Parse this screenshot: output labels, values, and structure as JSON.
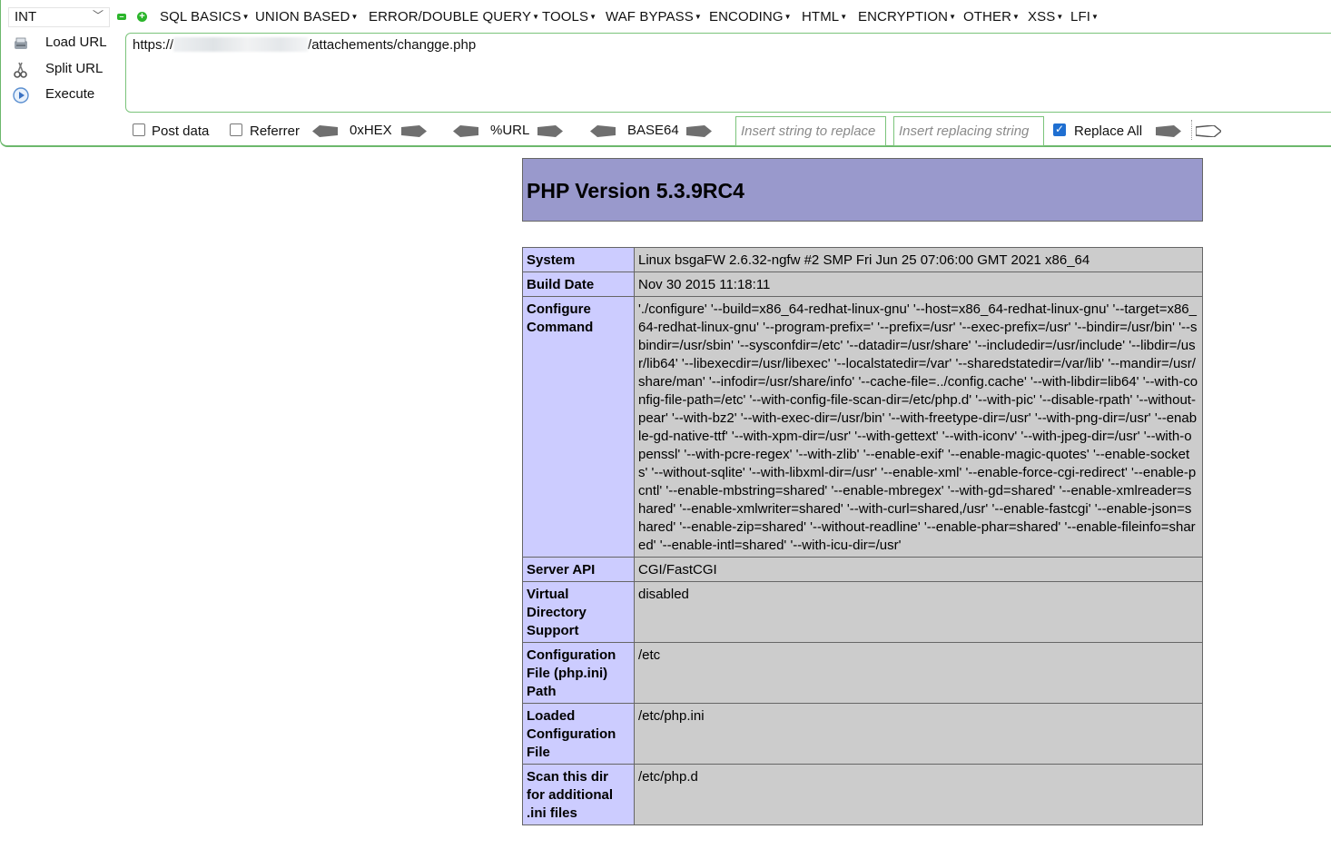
{
  "toolbar": {
    "encoding_select": "INT",
    "menus": [
      "SQL BASICS",
      "UNION BASED",
      "ERROR/DOUBLE QUERY",
      "TOOLS",
      "WAF BYPASS",
      "ENCODING",
      "HTML",
      "ENCRYPTION",
      "OTHER",
      "XSS",
      "LFI"
    ],
    "actions": {
      "load_url": "Load URL",
      "split_url": "Split URL",
      "execute": "Execute"
    },
    "url": {
      "prefix": "https://",
      "suffix": "/attachements/changge.php"
    },
    "options": {
      "post_data": "Post data",
      "post_data_checked": false,
      "referrer": "Referrer",
      "referrer_checked": false,
      "hex": "0xHEX",
      "url_enc": "%URL",
      "base64": "BASE64",
      "replace_placeholder": "Insert string to replace",
      "replacing_placeholder": "Insert replacing string",
      "replace_all": "Replace All",
      "replace_all_checked": true
    },
    "colors": {
      "border": "#7bc47b",
      "accent_green": "#2bb52b",
      "checkbox_blue": "#1f6fd1"
    }
  },
  "phpinfo": {
    "title": "PHP Version 5.3.9RC4",
    "header_color": "#9999cc",
    "key_color": "#ccccff",
    "value_color": "#cccccc",
    "rows": [
      {
        "key": "System",
        "value": "Linux bsgaFW 2.6.32-ngfw #2 SMP Fri Jun 25 07:06:00 GMT 2021 x86_64"
      },
      {
        "key": "Build Date",
        "value": "Nov 30 2015 11:18:11"
      },
      {
        "key": "Configure Command",
        "value": "'./configure' '--build=x86_64-redhat-linux-gnu' '--host=x86_64-redhat-linux-gnu' '--target=x86_64-redhat-linux-gnu' '--program-prefix=' '--prefix=/usr' '--exec-prefix=/usr' '--bindir=/usr/bin' '--sbindir=/usr/sbin' '--sysconfdir=/etc' '--datadir=/usr/share' '--includedir=/usr/include' '--libdir=/usr/lib64' '--libexecdir=/usr/libexec' '--localstatedir=/var' '--sharedstatedir=/var/lib' '--mandir=/usr/share/man' '--infodir=/usr/share/info' '--cache-file=../config.cache' '--with-libdir=lib64' '--with-config-file-path=/etc' '--with-config-file-scan-dir=/etc/php.d' '--with-pic' '--disable-rpath' '--without-pear' '--with-bz2' '--with-exec-dir=/usr/bin' '--with-freetype-dir=/usr' '--with-png-dir=/usr' '--enable-gd-native-ttf' '--with-xpm-dir=/usr' '--with-gettext' '--with-iconv' '--with-jpeg-dir=/usr' '--with-openssl' '--with-pcre-regex' '--with-zlib' '--enable-exif' '--enable-magic-quotes' '--enable-sockets' '--without-sqlite' '--with-libxml-dir=/usr' '--enable-xml' '--enable-force-cgi-redirect' '--enable-pcntl' '--enable-mbstring=shared' '--enable-mbregex' '--with-gd=shared' '--enable-xmlreader=shared' '--enable-xmlwriter=shared' '--with-curl=shared,/usr' '--enable-fastcgi' '--enable-json=shared' '--enable-zip=shared' '--without-readline' '--enable-phar=shared' '--enable-fileinfo=shared' '--enable-intl=shared' '--with-icu-dir=/usr'"
      },
      {
        "key": "Server API",
        "value": "CGI/FastCGI"
      },
      {
        "key": "Virtual Directory Support",
        "value": "disabled"
      },
      {
        "key": "Configuration File (php.ini) Path",
        "value": "/etc"
      },
      {
        "key": "Loaded Configuration File",
        "value": "/etc/php.ini"
      },
      {
        "key": "Scan this dir for additional .ini files",
        "value": "/etc/php.d"
      }
    ]
  }
}
